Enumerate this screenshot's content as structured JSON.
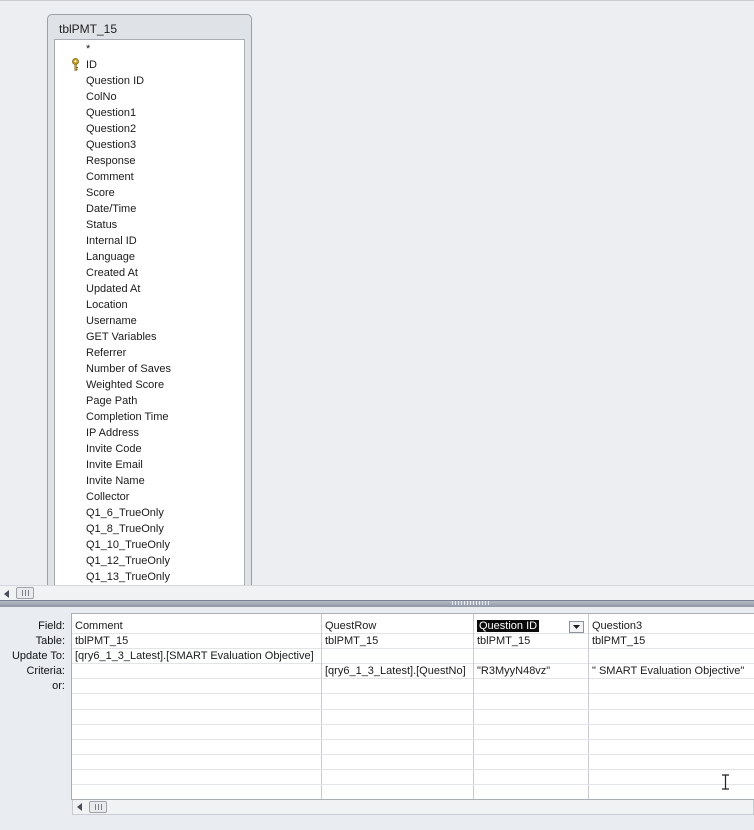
{
  "field_list": {
    "title": "tblPMT_15",
    "items": [
      "*",
      "ID",
      "Question ID",
      "ColNo",
      "Question1",
      "Question2",
      "Question3",
      "Response",
      "Comment",
      "Score",
      "Date/Time",
      "Status",
      "Internal ID",
      "Language",
      "Created At",
      "Updated At",
      "Location",
      "Username",
      "GET Variables",
      "Referrer",
      "Number of Saves",
      "Weighted Score",
      "Page Path",
      "Completion Time",
      "IP Address",
      "Invite Code",
      "Invite Email",
      "Invite Name",
      "Collector",
      "Q1_6_TrueOnly",
      "Q1_8_TrueOnly",
      "Q1_10_TrueOnly",
      "Q1_12_TrueOnly",
      "Q1_13_TrueOnly"
    ],
    "primary_key_icon": "key-icon"
  },
  "grid": {
    "row_labels": {
      "field": "Field:",
      "table": "Table:",
      "update_to": "Update To:",
      "criteria": "Criteria:",
      "or": "or:"
    },
    "columns": [
      {
        "field": "Comment",
        "table": "tblPMT_15",
        "update_to": "[qry6_1_3_Latest].[SMART Evaluation Objective]",
        "criteria": "",
        "or": ""
      },
      {
        "field": "QuestRow",
        "table": "tblPMT_15",
        "update_to": "",
        "criteria": "[qry6_1_3_Latest].[QuestNo]",
        "or": ""
      },
      {
        "field": "Question ID",
        "table": "tblPMT_15",
        "update_to": "",
        "criteria": "\"R3MyyN48vz\"",
        "or": ""
      },
      {
        "field": "Question3",
        "table": "tblPMT_15",
        "update_to": "",
        "criteria": "\" SMART Evaluation Objective\"",
        "or": ""
      }
    ]
  },
  "icons": {
    "scroll_left": "triangle-left-icon",
    "scroll_grip": "scroll-grip-icon",
    "dropdown": "chevron-down-icon",
    "cursor": "ibeam-cursor-icon"
  },
  "colors": {
    "selection": "#0b0b0b",
    "key_icon": "#c9a227"
  }
}
